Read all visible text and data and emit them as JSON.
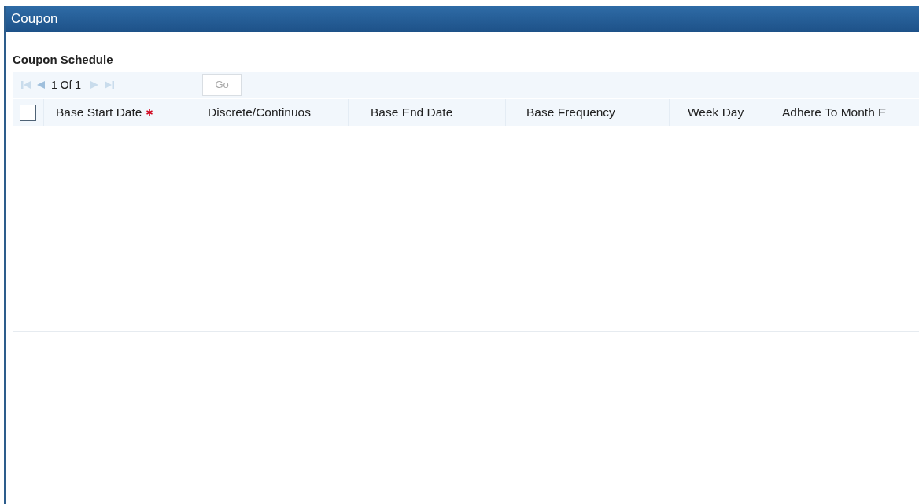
{
  "window": {
    "title": "Coupon"
  },
  "section": {
    "title": "Coupon Schedule"
  },
  "pager": {
    "page_text": "1 Of 1",
    "first_disabled": true,
    "prev_disabled": false,
    "next_disabled": true,
    "last_disabled": true,
    "go_label": "Go",
    "go_disabled": true
  },
  "table": {
    "select_all": {
      "checked": false
    },
    "columns": [
      {
        "label": "Base Start Date",
        "required": true
      },
      {
        "label": "Discrete/Continuos",
        "required": false
      },
      {
        "label": "Base End Date",
        "required": false
      },
      {
        "label": "Base Frequency",
        "required": false
      },
      {
        "label": "Week Day",
        "required": false
      },
      {
        "label": "Adhere To Month E",
        "required": false
      }
    ]
  }
}
